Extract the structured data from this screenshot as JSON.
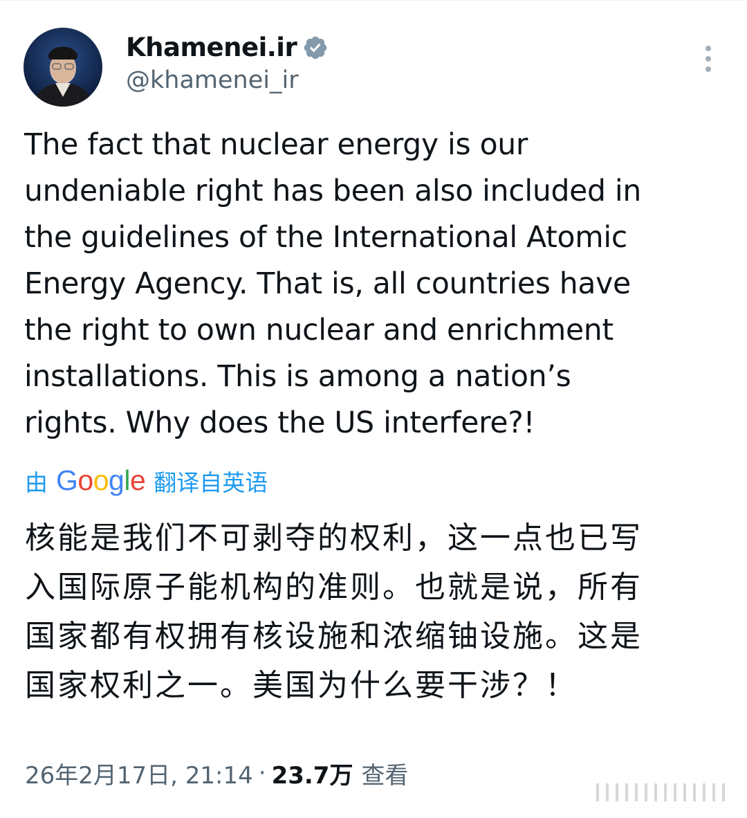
{
  "tweet": {
    "author": {
      "display_name": "Khamenei.ir",
      "handle": "@khamenei_ir",
      "verified_icon": "verified-badge-icon",
      "avatar": "profile-photo-avatar"
    },
    "more_icon": "more-vertical-icon",
    "text_lines": [
      "The fact that nuclear energy is our",
      "undeniable right has been also included in",
      "the guidelines of the International Atomic",
      "Energy Agency. That is, all countries have",
      "the right to own nuclear and enrichment",
      "installations. This is among a nation’s",
      "rights. Why does the US interfere?!"
    ],
    "translation": {
      "by": "由",
      "provider": "Google",
      "label": "翻译自英语",
      "color": "#1d9bf0",
      "lines": [
        "核能是我们不可剥夺的权利，这一点也已写",
        "入国际原子能机构的准则。也就是说，所有",
        "国家都有权拥有核设施和浓缩铀设施。这是",
        "国家权利之一。美国为什么要干涉？！"
      ]
    },
    "meta": {
      "timestamp": "26年2月17日, 21:14",
      "separator": "·",
      "views_count": "23.7万",
      "views_label": "查看"
    }
  },
  "colors": {
    "text_primary": "#0f1419",
    "text_secondary": "#536471",
    "accent": "#1d9bf0"
  }
}
